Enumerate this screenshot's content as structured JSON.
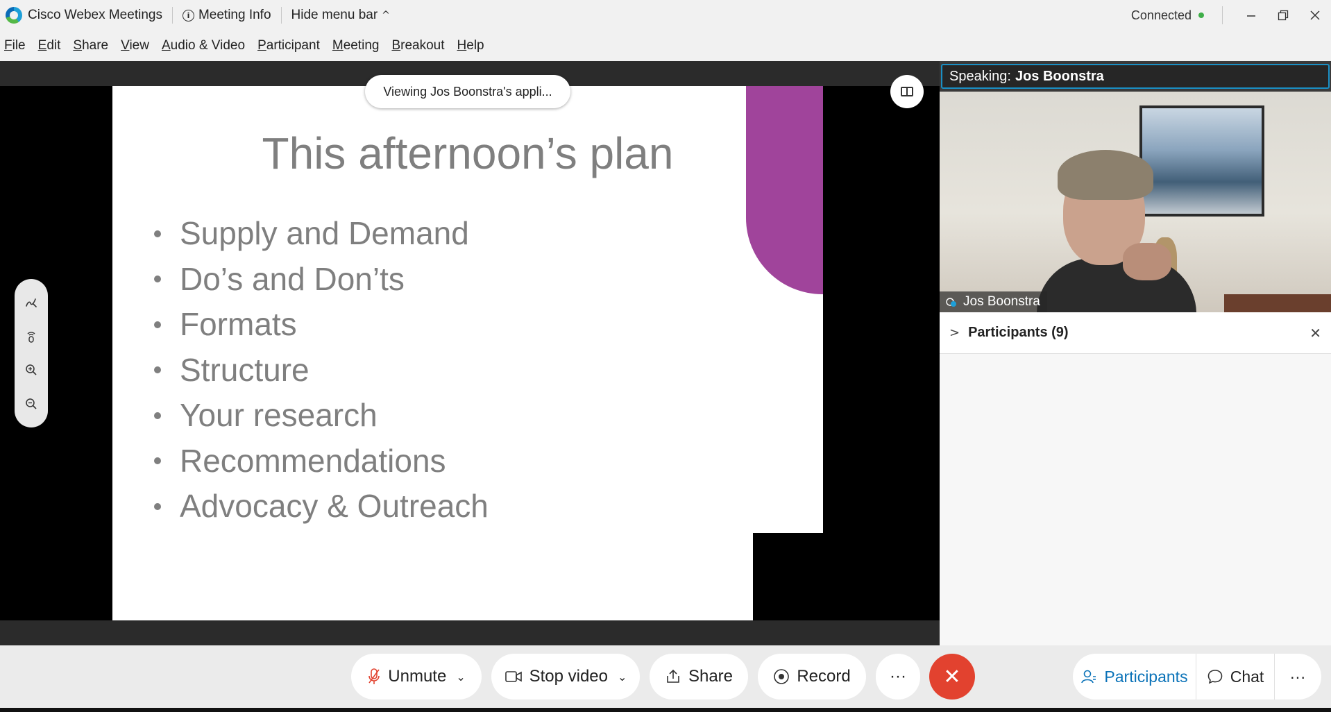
{
  "titlebar": {
    "app_title": "Cisco Webex Meetings",
    "meeting_info": "Meeting Info",
    "hide_menu_bar": "Hide menu bar",
    "status": "Connected",
    "status_color": "#3fae49"
  },
  "menubar": {
    "items": [
      {
        "first": "F",
        "rest": "ile"
      },
      {
        "first": "E",
        "rest": "dit"
      },
      {
        "first": "S",
        "rest": "hare"
      },
      {
        "first": "V",
        "rest": "iew"
      },
      {
        "first": "A",
        "rest": "udio & Video"
      },
      {
        "first": "P",
        "rest": "articipant"
      },
      {
        "first": "M",
        "rest": "eeting"
      },
      {
        "first": "B",
        "rest": "reakout"
      },
      {
        "first": "H",
        "rest": "elp"
      }
    ]
  },
  "share": {
    "viewing_banner": "Viewing Jos Boonstra's appli...",
    "slide": {
      "title": "This afternoon’s plan",
      "bullets": [
        "Supply and Demand",
        "Do’s and Don’ts",
        "Formats",
        "Structure",
        "Your research",
        "Recommendations",
        "Advocacy & Outreach"
      ],
      "accent_color": "#a0449b"
    },
    "tools": [
      "pen-icon",
      "pointer-icon",
      "zoom-in-icon",
      "zoom-out-icon"
    ]
  },
  "panel": {
    "speaking_label": "Speaking:",
    "speaker_name": "Jos Boonstra",
    "video_name_tag": "Jos Boonstra",
    "participants_title": "Participants (9)"
  },
  "controls": {
    "unmute": "Unmute",
    "stop_video": "Stop video",
    "share": "Share",
    "record": "Record",
    "more": "···",
    "participants": "Participants",
    "chat": "Chat",
    "accent_color": "#0a72b8",
    "end_color": "#e2422f"
  }
}
